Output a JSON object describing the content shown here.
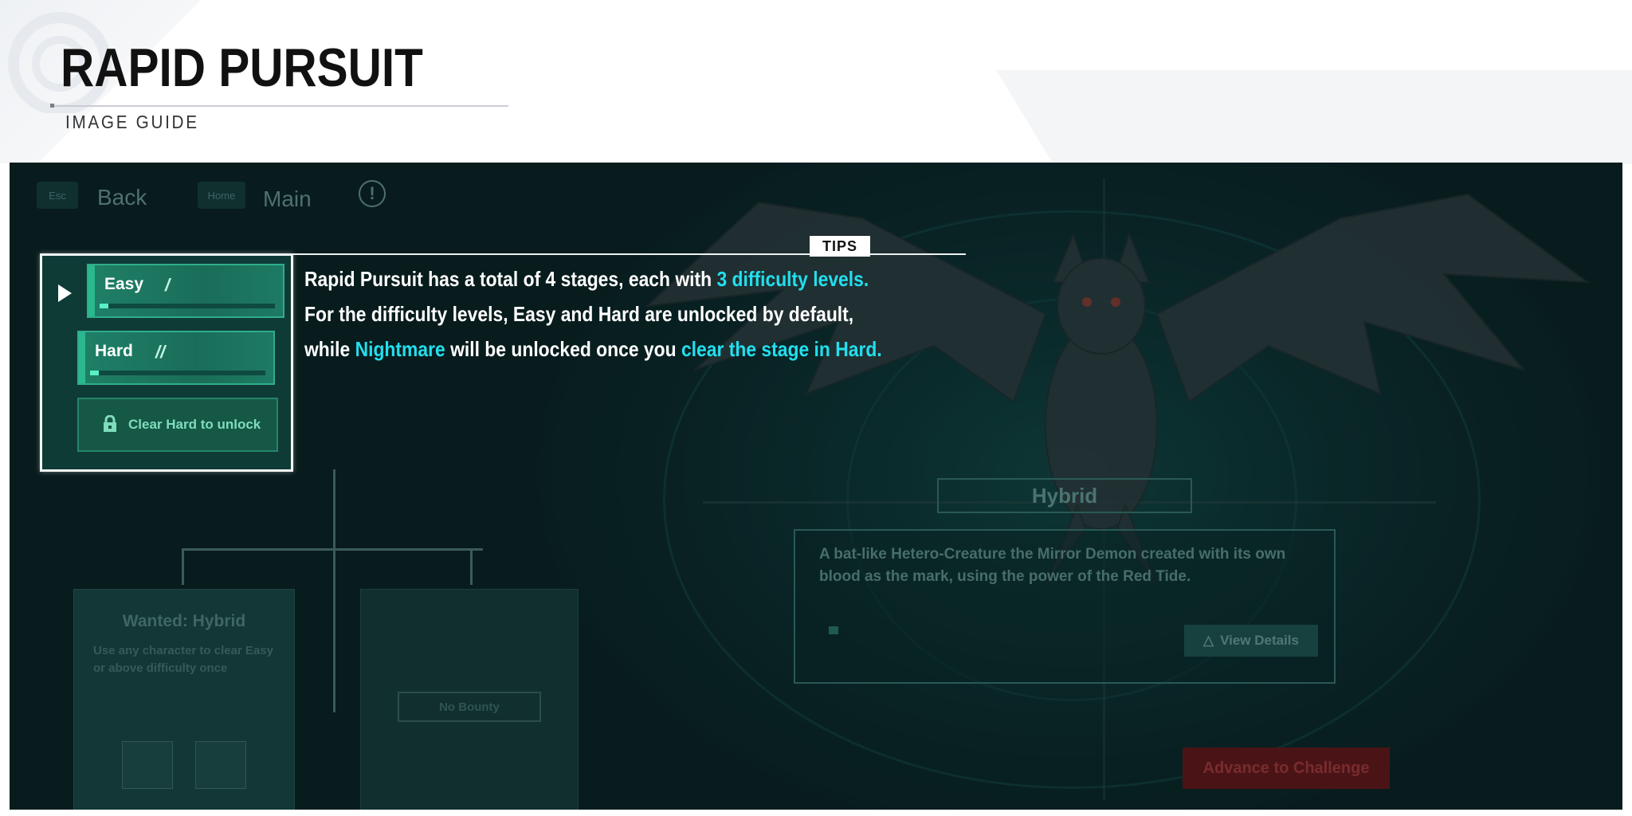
{
  "header": {
    "title": "RAPID PURSUIT",
    "subtitle": "IMAGE GUIDE"
  },
  "game": {
    "nav": {
      "back_key": "Esc",
      "back_label": "Back",
      "home_key": "Home",
      "home_label": "Main",
      "info_symbol": "!"
    },
    "difficulty": {
      "levels": [
        {
          "label": "Easy",
          "bars": "/",
          "progress": 0.05
        },
        {
          "label": "Hard",
          "bars": "//",
          "progress": 0.05
        }
      ],
      "locked_label": "Clear Hard to unlock"
    },
    "tips": {
      "tag": "TIPS",
      "line1_a": "Rapid Pursuit has a total of 4 stages, each with ",
      "line1_hl": "3 difficulty levels.",
      "line2": "For the difficulty levels, Easy and Hard are unlocked by default,",
      "line3_a": "while ",
      "line3_hl1": "Nightmare",
      "line3_b": " will be unlocked once you ",
      "line3_hl2": "clear the stage in Hard."
    },
    "wanted": {
      "title": "Wanted: Hybrid",
      "description": "Use any character to clear Easy or above difficulty once"
    },
    "bounty": {
      "label": "No Bounty"
    },
    "creature": {
      "name": "Hybrid",
      "description": "A bat-like Hetero-Creature the Mirror Demon created with its own blood as the mark, using the power of the Red Tide.",
      "view_details": "View Details",
      "view_icon": "triangle-icon"
    },
    "advance_label": "Advance to Challenge"
  },
  "colors": {
    "highlight": "#22dfee",
    "panel_green": "#1f8067",
    "advance_red": "#4a1416"
  }
}
